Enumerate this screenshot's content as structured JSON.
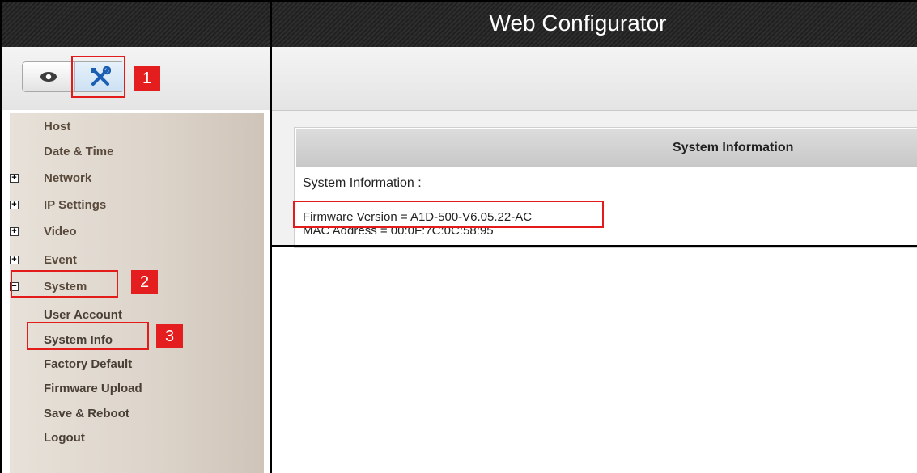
{
  "window_title": "Web Configurator",
  "toolbar": {
    "view_icon": "eye-icon",
    "config_icon": "tools-icon"
  },
  "sidebar": {
    "items": [
      {
        "label": "Host",
        "kind": "child"
      },
      {
        "label": "Date & Time",
        "kind": "child"
      },
      {
        "label": "Network",
        "kind": "group",
        "state": "+"
      },
      {
        "label": "IP Settings",
        "kind": "group",
        "state": "+"
      },
      {
        "label": "Video",
        "kind": "group",
        "state": "+"
      },
      {
        "label": "Event",
        "kind": "group",
        "state": "+"
      },
      {
        "label": "System",
        "kind": "group",
        "state": "−"
      },
      {
        "label": "User Account",
        "kind": "sub"
      },
      {
        "label": "System Info",
        "kind": "sub"
      },
      {
        "label": "Factory Default",
        "kind": "sub"
      },
      {
        "label": "Firmware Upload",
        "kind": "sub"
      },
      {
        "label": "Save & Reboot",
        "kind": "sub"
      },
      {
        "label": "Logout",
        "kind": "sub"
      }
    ]
  },
  "main": {
    "panel_title": "System Information",
    "info_label": "System Information :",
    "firmware_line": "Firmware Version = A1D-500-V6.05.22-AC",
    "mac_line": "MAC Address = 00:0F:7C:0C:58:95"
  },
  "annotations": {
    "step1": "1",
    "step2": "2",
    "step3": "3",
    "color": "#e31b1b"
  }
}
